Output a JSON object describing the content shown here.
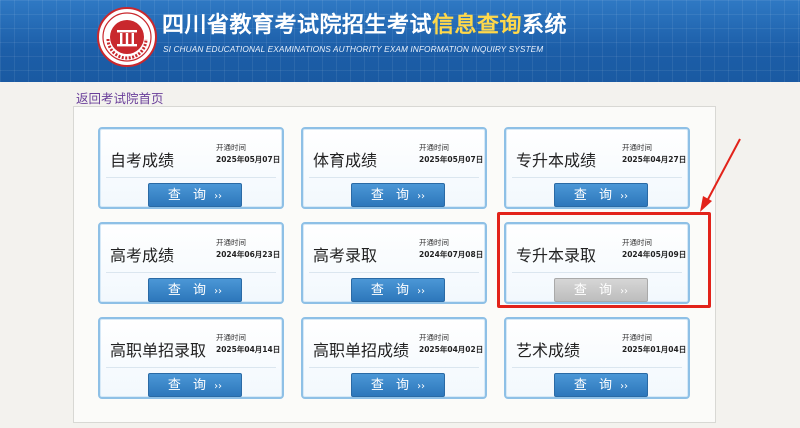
{
  "header": {
    "title_main": "四川省教育考试院招生考试",
    "title_highlight": "信息查询",
    "title_tail": "系统",
    "subtitle": "SI CHUAN EDUCATIONAL EXAMINATIONS AUTHORITY EXAM INFORMATION INQUIRY SYSTEM",
    "colors": {
      "bar": "#1c5ea8",
      "highlight": "#ffd84a",
      "logo_red": "#c9282d"
    }
  },
  "back_link": "返回考试院首页",
  "open_label": "开通时间",
  "button_label": "查 询",
  "button_arrow": "››",
  "cards": [
    {
      "name": "自考成绩",
      "date": "2025年05月07日",
      "enabled": true
    },
    {
      "name": "体育成绩",
      "date": "2025年05月07日",
      "enabled": true
    },
    {
      "name": "专升本成绩",
      "date": "2025年04月27日",
      "enabled": true
    },
    {
      "name": "高考成绩",
      "date": "2024年06月23日",
      "enabled": true
    },
    {
      "name": "高考录取",
      "date": "2024年07月08日",
      "enabled": true
    },
    {
      "name": "专升本录取",
      "date": "2024年05月09日",
      "enabled": false
    },
    {
      "name": "高职单招录取",
      "date": "2025年04月14日",
      "enabled": true
    },
    {
      "name": "高职单招成绩",
      "date": "2025年04月02日",
      "enabled": true
    },
    {
      "name": "艺术成绩",
      "date": "2025年01月04日",
      "enabled": true
    }
  ],
  "annotation": {
    "color": "#e2231a",
    "target": "专升本录取"
  }
}
